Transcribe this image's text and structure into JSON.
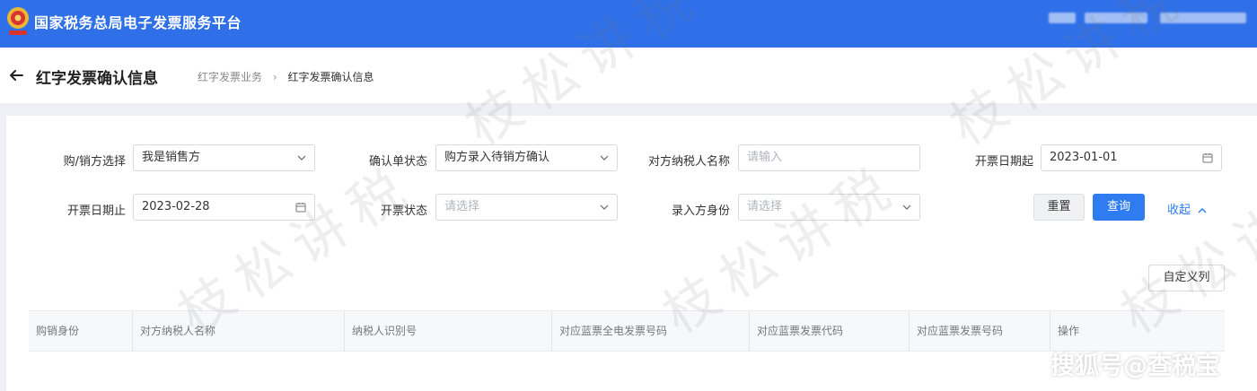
{
  "app": {
    "title": "国家税务总局电子发票服务平台"
  },
  "header": {
    "title": "红字发票确认信息",
    "breadcrumb": [
      "红字发票业务",
      "红字发票确认信息"
    ]
  },
  "filters": {
    "buyer_seller": {
      "label": "购/销方选择",
      "value": "我是销售方"
    },
    "confirm_status": {
      "label": "确认单状态",
      "value": "购方录入待销方确认"
    },
    "counterparty_name": {
      "label": "对方纳税人名称",
      "placeholder": "请输入"
    },
    "issue_date_start": {
      "label": "开票日期起",
      "value": "2023-01-01"
    },
    "issue_date_end": {
      "label": "开票日期止",
      "value": "2023-02-28"
    },
    "issue_status": {
      "label": "开票状态",
      "placeholder": "请选择"
    },
    "entry_identity": {
      "label": "录入方身份",
      "placeholder": "请选择"
    }
  },
  "actions": {
    "reset": "重置",
    "query": "查询",
    "collapse": "收起",
    "custom_columns": "自定义列"
  },
  "table": {
    "columns": [
      "购销身份",
      "对方纳税人名称",
      "纳税人识别号",
      "对应蓝票全电发票号码",
      "对应蓝票发票代码",
      "对应蓝票发票号码",
      "操作"
    ]
  },
  "watermark": {
    "text": "枝松讲税"
  },
  "source_mark": "搜狐号@查税宝",
  "colors": {
    "topbar": "#2f6fe8",
    "primary_button": "#2f7cf0",
    "link": "#2f7cf0"
  },
  "icons": [
    "emblem-logo",
    "back-arrow-icon",
    "chevron-right-icon",
    "chevron-down-icon",
    "calendar-icon",
    "chevron-up-icon"
  ]
}
